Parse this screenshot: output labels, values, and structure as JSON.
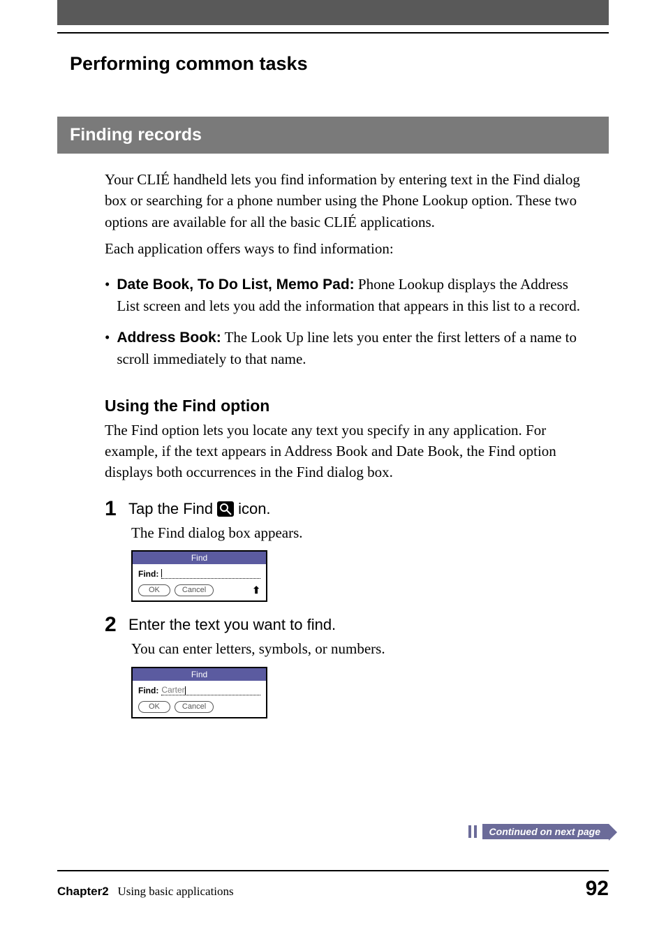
{
  "header": {
    "breadcrumb": "Performing common tasks"
  },
  "section": {
    "title": "Finding records"
  },
  "intro": {
    "p1": "Your CLIÉ handheld lets you find information by entering text in the Find dialog box or searching for a phone number using the Phone Lookup option. These two options are available for all the basic CLIÉ applications.",
    "p2": "Each application offers ways to find information:"
  },
  "bullets": [
    {
      "bold": "Date Book, To Do List, Memo Pad:",
      "rest": " Phone Lookup displays the Address List screen and lets you add the information that appears in this list to a record."
    },
    {
      "bold": "Address Book:",
      "rest": " The Look Up line lets you enter the first letters of a name to scroll immediately to that name."
    }
  ],
  "subheading": "Using the Find option",
  "subintro": "The Find option lets you locate any text you specify in any application. For example, if the text appears in Address Book and Date Book, the Find option displays both occurrences in the Find dialog box.",
  "steps": [
    {
      "num": "1",
      "pre": "Tap the Find ",
      "post": " icon.",
      "after": "The Find dialog box appears.",
      "dialog": {
        "title": "Find",
        "label": "Find:",
        "value": "",
        "ok": "OK",
        "cancel": "Cancel",
        "show_up": true
      }
    },
    {
      "num": "2",
      "pre": "Enter the text you want to find.",
      "post": "",
      "after": "You can enter letters, symbols, or numbers.",
      "dialog": {
        "title": "Find",
        "label": "Find:",
        "value": "Carter",
        "ok": "OK",
        "cancel": "Cancel",
        "show_up": false
      }
    }
  ],
  "continued": "Continued on next page",
  "footer": {
    "chapter_label": "Chapter2",
    "chapter_title": "Using basic applications",
    "page": "92"
  }
}
